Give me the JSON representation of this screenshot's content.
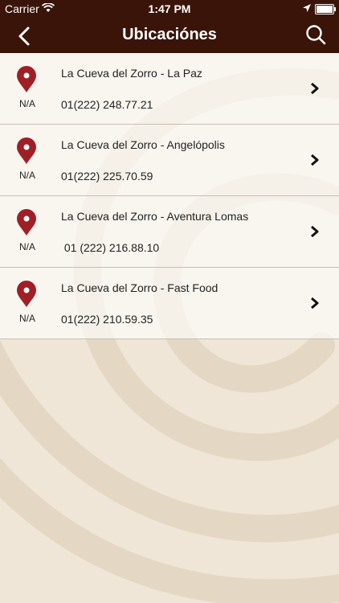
{
  "status_bar": {
    "carrier": "Carrier",
    "time": "1:47 PM"
  },
  "nav": {
    "title": "Ubicaciónes"
  },
  "colors": {
    "bar": "#3a1409",
    "pin": "#a01f27"
  },
  "locations": [
    {
      "name": "La Cueva del Zorro - La Paz",
      "phone": "01(222) 248.77.21",
      "distance": "N/A"
    },
    {
      "name": "La Cueva del Zorro - Angelópolis",
      "phone": "01(222) 225.70.59",
      "distance": "N/A"
    },
    {
      "name": "La Cueva del Zorro - Aventura Lomas",
      "phone": " 01 (222) 216.88.10",
      "distance": "N/A"
    },
    {
      "name": "La Cueva del Zorro - Fast Food",
      "phone": "01(222) 210.59.35",
      "distance": "N/A"
    }
  ]
}
